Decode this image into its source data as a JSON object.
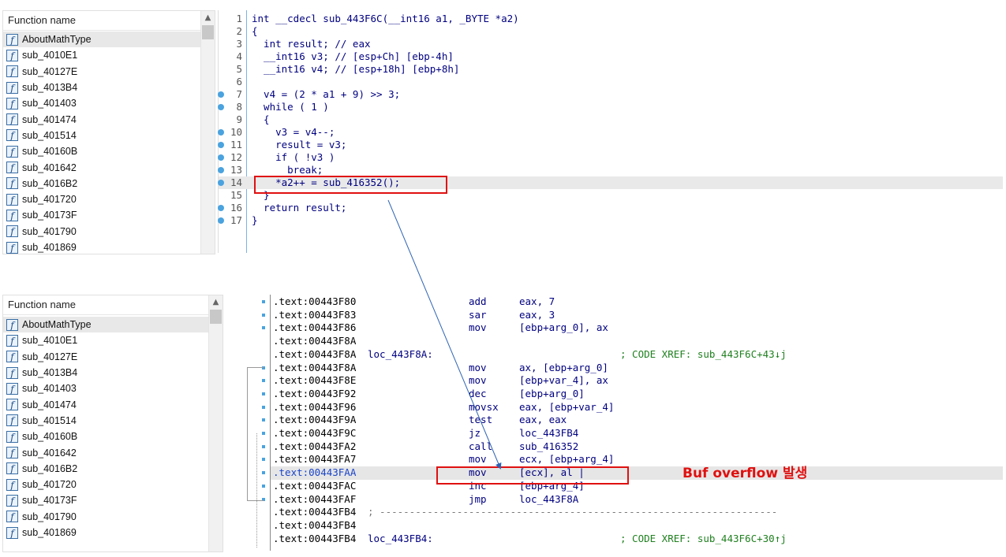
{
  "function_panel": {
    "header": "Function name",
    "items": [
      "AboutMathType",
      "sub_4010E1",
      "sub_40127E",
      "sub_4013B4",
      "sub_401403",
      "sub_401474",
      "sub_401514",
      "sub_40160B",
      "sub_401642",
      "sub_4016B2",
      "sub_401720",
      "sub_40173F",
      "sub_401790",
      "sub_401869"
    ],
    "icon_glyph": "f"
  },
  "pseudocode": {
    "lines": [
      {
        "n": "1",
        "html": "int __cdecl sub_443F6C(__int16 a1, _BYTE *a2)",
        "bp": false
      },
      {
        "n": "2",
        "html": "{",
        "bp": false
      },
      {
        "n": "3",
        "html": "  int result; // eax",
        "bp": false
      },
      {
        "n": "4",
        "html": "  __int16 v3; // [esp+Ch] [ebp-4h]",
        "bp": false
      },
      {
        "n": "5",
        "html": "  __int16 v4; // [esp+18h] [ebp+8h]",
        "bp": false
      },
      {
        "n": "6",
        "html": "",
        "bp": false
      },
      {
        "n": "7",
        "html": "  v4 = (2 * a1 + 9) >> 3;",
        "bp": true
      },
      {
        "n": "8",
        "html": "  while ( 1 )",
        "bp": true
      },
      {
        "n": "9",
        "html": "  {",
        "bp": false
      },
      {
        "n": "10",
        "html": "    v3 = v4--;",
        "bp": true
      },
      {
        "n": "11",
        "html": "    result = v3;",
        "bp": true
      },
      {
        "n": "12",
        "html": "    if ( !v3 )",
        "bp": true
      },
      {
        "n": "13",
        "html": "      break;",
        "bp": true
      },
      {
        "n": "14",
        "html": "    *a2++ = sub_416352();",
        "bp": true
      },
      {
        "n": "15",
        "html": "  }",
        "bp": false
      },
      {
        "n": "16",
        "html": "  return result;",
        "bp": true
      },
      {
        "n": "17",
        "html": "}",
        "bp": true
      }
    ]
  },
  "disassembly": {
    "lines": [
      {
        "addr": ".text:00443F80",
        "label": "",
        "mn": "add",
        "op": "eax, 7",
        "xref": ""
      },
      {
        "addr": ".text:00443F83",
        "label": "",
        "mn": "sar",
        "op": "eax, 3",
        "xref": ""
      },
      {
        "addr": ".text:00443F86",
        "label": "",
        "mn": "mov",
        "op": "[ebp+arg_0], ax",
        "xref": ""
      },
      {
        "addr": ".text:00443F8A",
        "label": "",
        "mn": "",
        "op": "",
        "xref": ""
      },
      {
        "addr": ".text:00443F8A",
        "label": "loc_443F8A:",
        "mn": "",
        "op": "",
        "xref": "; CODE XREF: sub_443F6C+43↓j"
      },
      {
        "addr": ".text:00443F8A",
        "label": "",
        "mn": "mov",
        "op": "ax, [ebp+arg_0]",
        "xref": ""
      },
      {
        "addr": ".text:00443F8E",
        "label": "",
        "mn": "mov",
        "op": "[ebp+var_4], ax",
        "xref": ""
      },
      {
        "addr": ".text:00443F92",
        "label": "",
        "mn": "dec",
        "op": "[ebp+arg_0]",
        "xref": ""
      },
      {
        "addr": ".text:00443F96",
        "label": "",
        "mn": "movsx",
        "op": "eax, [ebp+var_4]",
        "xref": ""
      },
      {
        "addr": ".text:00443F9A",
        "label": "",
        "mn": "test",
        "op": "eax, eax",
        "xref": ""
      },
      {
        "addr": ".text:00443F9C",
        "label": "",
        "mn": "jz",
        "op": "loc_443FB4",
        "xref": ""
      },
      {
        "addr": ".text:00443FA2",
        "label": "",
        "mn": "call",
        "op": "sub_416352",
        "xref": ""
      },
      {
        "addr": ".text:00443FA7",
        "label": "",
        "mn": "mov",
        "op": "ecx, [ebp+arg_4]",
        "xref": ""
      },
      {
        "addr": ".text:00443FAA",
        "label": "",
        "mn": "mov",
        "op": "[ecx], al |",
        "xref": ""
      },
      {
        "addr": ".text:00443FAC",
        "label": "",
        "mn": "inc",
        "op": "[ebp+arg_4]",
        "xref": ""
      },
      {
        "addr": ".text:00443FAF",
        "label": "",
        "mn": "jmp",
        "op": "loc_443F8A",
        "xref": ""
      },
      {
        "addr": ".text:00443FB4",
        "label": "; -------------------------------------------------------------------",
        "mn": "",
        "op": "",
        "xref": ""
      },
      {
        "addr": ".text:00443FB4",
        "label": "",
        "mn": "",
        "op": "",
        "xref": ""
      },
      {
        "addr": ".text:00443FB4",
        "label": "loc_443FB4:",
        "mn": "",
        "op": "",
        "xref": "; CODE XREF: sub_443F6C+30↑j"
      }
    ]
  },
  "annotation": {
    "text": "Buf overflow 발생"
  },
  "colors": {
    "highlight_box": "#e01010",
    "arrow": "#2e64b4",
    "address_selected": "#1a44c8"
  }
}
